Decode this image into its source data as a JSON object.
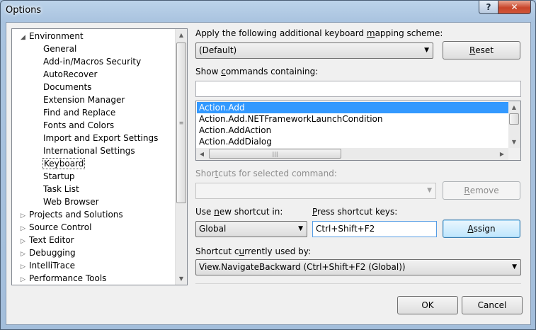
{
  "window": {
    "title": "Options"
  },
  "tree": {
    "items": [
      {
        "label": "Environment",
        "level": 0,
        "expander": "expanded"
      },
      {
        "label": "General",
        "level": 1
      },
      {
        "label": "Add-in/Macros Security",
        "level": 1
      },
      {
        "label": "AutoRecover",
        "level": 1
      },
      {
        "label": "Documents",
        "level": 1
      },
      {
        "label": "Extension Manager",
        "level": 1
      },
      {
        "label": "Find and Replace",
        "level": 1
      },
      {
        "label": "Fonts and Colors",
        "level": 1
      },
      {
        "label": "Import and Export Settings",
        "level": 1
      },
      {
        "label": "International Settings",
        "level": 1
      },
      {
        "label": "Keyboard",
        "level": 1,
        "selected": true
      },
      {
        "label": "Startup",
        "level": 1
      },
      {
        "label": "Task List",
        "level": 1
      },
      {
        "label": "Web Browser",
        "level": 1
      },
      {
        "label": "Projects and Solutions",
        "level": 0,
        "expander": "collapsed"
      },
      {
        "label": "Source Control",
        "level": 0,
        "expander": "collapsed"
      },
      {
        "label": "Text Editor",
        "level": 0,
        "expander": "collapsed"
      },
      {
        "label": "Debugging",
        "level": 0,
        "expander": "collapsed"
      },
      {
        "label": "IntelliTrace",
        "level": 0,
        "expander": "collapsed"
      },
      {
        "label": "Performance Tools",
        "level": 0,
        "expander": "collapsed"
      }
    ]
  },
  "mapping": {
    "label_a": "Apply the following additional keyboard ",
    "label_u": "m",
    "label_b": "apping scheme:",
    "value": "(Default)",
    "reset_u": "R",
    "reset_rest": "eset"
  },
  "commands": {
    "label_a": "Show ",
    "label_u": "c",
    "label_b": "ommands containing:",
    "filter_value": "",
    "items": [
      "Action.Add",
      "Action.Add.NETFrameworkLaunchCondition",
      "Action.AddAction",
      "Action.AddDialog"
    ],
    "selected_index": 0
  },
  "shortcuts": {
    "label_a": "Shor",
    "label_u": "t",
    "label_b": "cuts for selected command:",
    "value": "",
    "remove_u": "R",
    "remove_rest": "emove"
  },
  "new_shortcut": {
    "use_label_a": "Use ",
    "use_label_u": "n",
    "use_label_b": "ew shortcut in:",
    "scope_value": "Global",
    "press_label_a": "",
    "press_label_u": "P",
    "press_label_b": "ress shortcut keys:",
    "keys_value": "Ctrl+Shift+F2",
    "assign_u": "A",
    "assign_rest": "ssign"
  },
  "used_by": {
    "label_a": "Shortcut c",
    "label_u": "u",
    "label_b": "rrently used by:",
    "value": "View.NavigateBackward (Ctrl+Shift+F2 (Global))"
  },
  "footer": {
    "ok_label": "OK",
    "cancel_label": "Cancel"
  },
  "icons": {
    "help": "?",
    "close": "✕",
    "expanded": "◢",
    "collapsed": "▷",
    "dropdown": "▼",
    "scroll_up": "▲",
    "scroll_down": "▼",
    "scroll_left": "◀",
    "scroll_right": "▶",
    "grip_v": "≡",
    "grip_h": "|||"
  }
}
